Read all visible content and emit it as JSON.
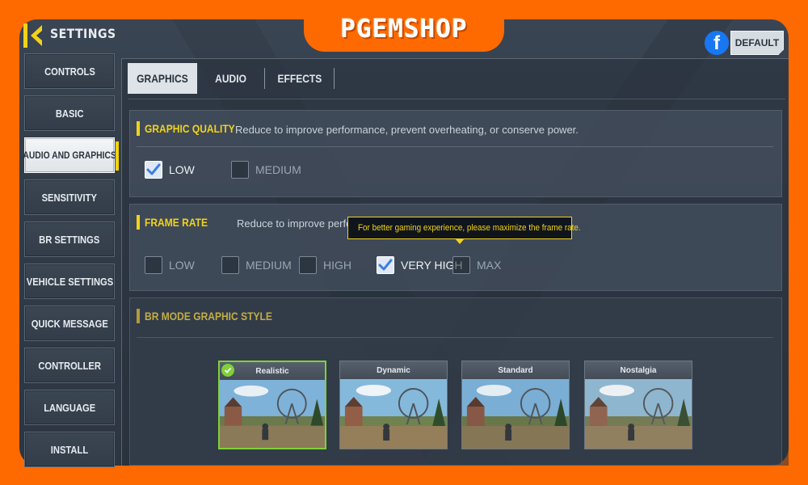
{
  "brand": {
    "logo_text": "PGEMSHOP"
  },
  "header": {
    "title": "SETTINGS",
    "default_label": "DEFAULT",
    "facebook_letter": "f"
  },
  "sidebar": {
    "items": [
      {
        "label": "CONTROLS"
      },
      {
        "label": "BASIC"
      },
      {
        "label": "AUDIO AND GRAPHICS",
        "active": true
      },
      {
        "label": "SENSITIVITY"
      },
      {
        "label": "BR SETTINGS"
      },
      {
        "label": "VEHICLE SETTINGS"
      },
      {
        "label": "QUICK MESSAGE"
      },
      {
        "label": "CONTROLLER"
      },
      {
        "label": "LANGUAGE"
      },
      {
        "label": "INSTALL"
      }
    ]
  },
  "tabs": [
    {
      "label": "GRAPHICS",
      "active": true
    },
    {
      "label": "AUDIO"
    },
    {
      "label": "EFFECTS"
    }
  ],
  "graphic_quality": {
    "title": "GRAPHIC QUALITY",
    "description": "Reduce to improve performance, prevent overheating, or conserve power.",
    "options": [
      {
        "label": "LOW",
        "checked": true
      },
      {
        "label": "MEDIUM",
        "checked": false
      }
    ]
  },
  "frame_rate": {
    "title": "FRAME RATE",
    "description": "Reduce to improve perform",
    "tooltip": "For better gaming experience, please maximize the frame rate.",
    "options": [
      {
        "label": "LOW",
        "checked": false
      },
      {
        "label": "MEDIUM",
        "checked": false
      },
      {
        "label": "HIGH",
        "checked": false
      },
      {
        "label": "VERY HIGH",
        "checked": true
      },
      {
        "label": "MAX",
        "checked": false
      }
    ]
  },
  "br_mode_style": {
    "title": "BR MODE GRAPHIC STYLE",
    "styles": [
      {
        "label": "Realistic",
        "selected": true
      },
      {
        "label": "Dynamic",
        "selected": false
      },
      {
        "label": "Standard",
        "selected": false
      },
      {
        "label": "Nostalgia",
        "selected": false
      }
    ]
  },
  "colors": {
    "frame_orange": "#ff6a00",
    "accent_yellow": "#f2d21b",
    "selected_green": "#7fd138",
    "facebook_blue": "#1877f2"
  }
}
